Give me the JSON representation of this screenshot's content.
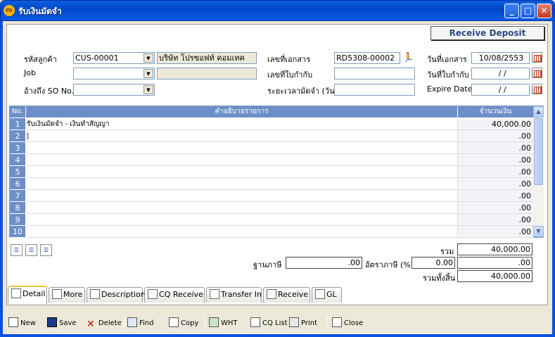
{
  "window": {
    "title": "รับเงินมัดจำ",
    "app_icon": "m"
  },
  "header_badge": "Receive Deposit",
  "form": {
    "customer_code_label": "รหัสลูกค้า",
    "customer_code": "CUS-00001",
    "customer_name": "บริษัท โปรซอฟท์ คอมเทค",
    "job_label": "Job",
    "job": "",
    "ref_so_label": "อ้างถึง SO No.",
    "ref_so": "",
    "doc_no_label": "เลขที่เอกสาร",
    "doc_no": "RD5308-00002",
    "tax_invoice_label": "เลขที่ใบกำกับ",
    "tax_invoice": "",
    "deposit_period_label": "ระยะเวลามัดจำ (วัน)",
    "deposit_period": "",
    "doc_date_label": "วันที่เอกสาร",
    "doc_date": "10/08/2553",
    "invoice_date_label": "วันที่ใบกำกับ",
    "invoice_date": " / /",
    "expire_date_label": "Expire Date",
    "expire_date": " / /"
  },
  "grid": {
    "headers": {
      "no": "No.",
      "description": "คำอธิบายรายการ",
      "amount": "จำนวนเงิน"
    },
    "rows": [
      {
        "no": "1",
        "description": "รับเงินมัดจำ - เงินทำสัญญา",
        "amount": "40,000.00"
      },
      {
        "no": "2",
        "description": "|",
        "amount": ".00"
      },
      {
        "no": "3",
        "description": "",
        "amount": ".00"
      },
      {
        "no": "4",
        "description": "",
        "amount": ".00"
      },
      {
        "no": "5",
        "description": "",
        "amount": ".00"
      },
      {
        "no": "6",
        "description": "",
        "amount": ".00"
      },
      {
        "no": "7",
        "description": "",
        "amount": ".00"
      },
      {
        "no": "8",
        "description": "",
        "amount": ".00"
      },
      {
        "no": "9",
        "description": "",
        "amount": ".00"
      },
      {
        "no": "10",
        "description": "",
        "amount": ".00"
      }
    ]
  },
  "totals": {
    "sum_label": "รวม",
    "sum": "40,000.00",
    "tax_base_label": "ฐานภาษี",
    "tax_base": ".00",
    "tax_rate_label": "อัตราภาษี (%)",
    "tax_rate": "0.00",
    "tax_amount": ".00",
    "grand_total_label": "รวมทั้งสิ้น",
    "grand_total": "40,000.00"
  },
  "tabs": [
    "Detail",
    "More",
    "Description",
    "CQ Receive",
    "Transfer In",
    "Receive",
    "GL"
  ],
  "toolbar": {
    "new": "New",
    "save": "Save",
    "delete": "Delete",
    "find": "Find",
    "copy": "Copy",
    "wht": "WHT",
    "cq_list": "CQ List",
    "print": "Print",
    "close": "Close"
  },
  "colors": {
    "title_bar": "#0346c8",
    "grid_header": "#6d8fc9",
    "badge_text": "#2a4a8a"
  }
}
